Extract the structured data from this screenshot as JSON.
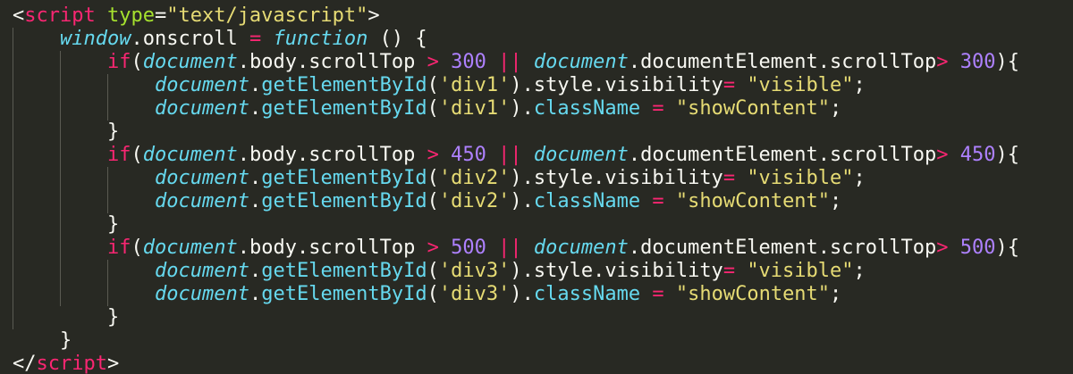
{
  "code": {
    "l1": {
      "lt": "<",
      "tag": "script",
      "sp": " ",
      "attr": "type",
      "eq": "=",
      "val": "\"text/javascript\"",
      "gt": ">"
    },
    "l2": {
      "window": "window",
      "dot": ".",
      "prop": "onscroll",
      "eq": " = ",
      "function": "function",
      "rest": " () {"
    },
    "blocks": [
      {
        "if": "if",
        "open": "(",
        "doc1": "document",
        "p1": ".body.scrollTop ",
        "gt": ">",
        "sp1": " ",
        "n1": "300",
        "sp2": " ",
        "or": "||",
        "sp3": " ",
        "doc2": "document",
        "p2": ".documentElement.scrollTop",
        "gt2": ">",
        "sp4": " ",
        "n2": "300",
        "close": "){",
        "s1": {
          "doc": "document",
          "dot": ".",
          "fn": "getElementById",
          "a": "(",
          "arg": "'div1'",
          "b": ").style.visibility",
          "eq": "=",
          "sp": " ",
          "val": "\"visible\"",
          "end": ";"
        },
        "s2": {
          "doc": "document",
          "dot": ".",
          "fn": "getElementById",
          "a": "(",
          "arg": "'div1'",
          "b": ").",
          "prop": "className",
          "eq": " = ",
          "val": "\"showContent\"",
          "end": ";"
        },
        "brace": "}"
      },
      {
        "if": "if",
        "open": "(",
        "doc1": "document",
        "p1": ".body.scrollTop ",
        "gt": ">",
        "sp1": " ",
        "n1": "450",
        "sp2": " ",
        "or": "||",
        "sp3": " ",
        "doc2": "document",
        "p2": ".documentElement.scrollTop",
        "gt2": ">",
        "sp4": " ",
        "n2": "450",
        "close": "){",
        "s1": {
          "doc": "document",
          "dot": ".",
          "fn": "getElementById",
          "a": "(",
          "arg": "'div2'",
          "b": ").style.visibility",
          "eq": "=",
          "sp": " ",
          "val": "\"visible\"",
          "end": ";"
        },
        "s2": {
          "doc": "document",
          "dot": ".",
          "fn": "getElementById",
          "a": "(",
          "arg": "'div2'",
          "b": ").",
          "prop": "className",
          "eq": " = ",
          "val": "\"showContent\"",
          "end": ";"
        },
        "brace": "}"
      },
      {
        "if": "if",
        "open": "(",
        "doc1": "document",
        "p1": ".body.scrollTop ",
        "gt": ">",
        "sp1": " ",
        "n1": "500",
        "sp2": " ",
        "or": "||",
        "sp3": " ",
        "doc2": "document",
        "p2": ".documentElement.scrollTop",
        "gt2": ">",
        "sp4": " ",
        "n2": "500",
        "close": "){",
        "s1": {
          "doc": "document",
          "dot": ".",
          "fn": "getElementById",
          "a": "(",
          "arg": "'div3'",
          "b": ").style.visibility",
          "eq": "=",
          "sp": " ",
          "val": "\"visible\"",
          "end": ";"
        },
        "s2": {
          "doc": "document",
          "dot": ".",
          "fn": "getElementById",
          "a": "(",
          "arg": "'div3'",
          "b": ").",
          "prop": "className",
          "eq": " = ",
          "val": "\"showContent\"",
          "end": ";"
        },
        "brace": "}"
      }
    ],
    "l16": "}",
    "l17": {
      "lt": "</",
      "tag": "script",
      "gt": ">"
    }
  },
  "colors": {
    "background": "#282923",
    "tag": "#f92672",
    "attribute": "#a6e22e",
    "string": "#e6db74",
    "number": "#ae81ff",
    "builtin": "#66d9ef",
    "plain": "#f8f8f2"
  }
}
